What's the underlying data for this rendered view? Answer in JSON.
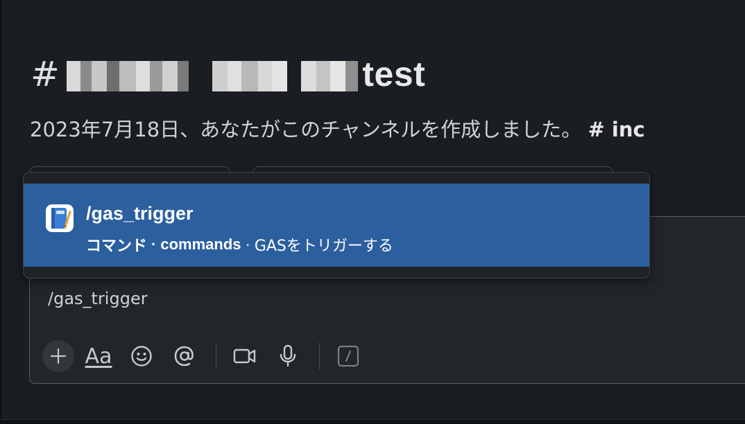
{
  "channel": {
    "hash": "#",
    "title_suffix": "test",
    "description": "2023年7月18日、あなたがこのチャンネルを作成しました。",
    "description_link": "# inc"
  },
  "autocomplete": {
    "command": "/gas_trigger",
    "type_label": "コマンド",
    "separator": "·",
    "app_name": "commands",
    "description": "GASをトリガーする",
    "highlight_color": "#2c5f9e"
  },
  "composer": {
    "text": "/gas_trigger",
    "format_label": "Aa"
  },
  "icons": {
    "attach": "plus-icon",
    "format": "text-format-icon",
    "emoji": "emoji-icon",
    "mention": "at-mention-icon",
    "video": "video-icon",
    "audio": "microphone-icon",
    "shortcut": "slash-command-icon",
    "app": "app-notebook-icon"
  }
}
